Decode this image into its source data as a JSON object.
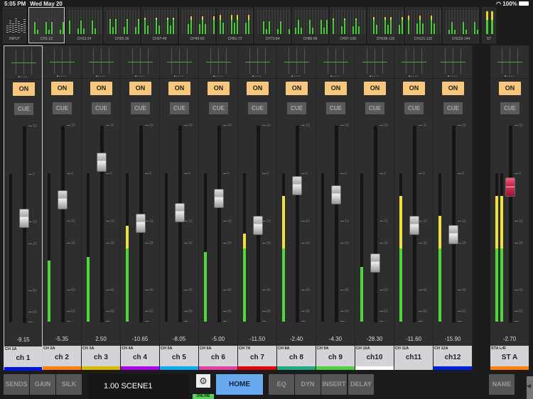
{
  "status": {
    "time": "5:05 PM",
    "date": "Wed May 20",
    "battery": "100%"
  },
  "overview": {
    "input_label": "INPUT",
    "banks": [
      "CH1-12",
      "CH13-24",
      "CH25-36",
      "CH37-48",
      "CH49-60",
      "CH61-72",
      "CH73-84",
      "CH85-96",
      "CH97-108",
      "CH109-120",
      "CH121-132",
      "CH133-144"
    ],
    "selected_bank": "CH1-12",
    "st_label": "ST"
  },
  "on_label": "ON",
  "cue_label": "CUE",
  "scale": [
    "10",
    "0",
    "10",
    "20",
    "40",
    "60",
    "-"
  ],
  "channels": [
    {
      "id": "CH 1A",
      "name": "ch 1",
      "value": "-9.15",
      "db": -9.15,
      "meter": 0,
      "color": "#0014e0"
    },
    {
      "id": "CH 2A",
      "name": "ch 2",
      "value": "-5.35",
      "db": -5.35,
      "meter": 0.31,
      "color": "#ff7f10"
    },
    {
      "id": "CH 3A",
      "name": "ch 3",
      "value": "2.50",
      "db": 2.5,
      "meter": 0.33,
      "color": "#d4bc00"
    },
    {
      "id": "CH 4A",
      "name": "ch 4",
      "value": "-10.65",
      "db": -10.65,
      "meter": 0.49,
      "color": "#b000e8"
    },
    {
      "id": "CH 5A",
      "name": "ch 5",
      "value": "-8.05",
      "db": -8.05,
      "meter": 0,
      "color": "#10a8f0"
    },
    {
      "id": "CH 6A",
      "name": "ch 6",
      "value": "-5.00",
      "db": -5.0,
      "meter": 0.355,
      "color": "#e040a0"
    },
    {
      "id": "CH 7A",
      "name": "ch 7",
      "value": "-11.50",
      "db": -11.5,
      "meter": 0.45,
      "color": "#e00010"
    },
    {
      "id": "CH 8A",
      "name": "ch 8",
      "value": "-2.40",
      "db": -2.4,
      "meter": 0.64,
      "color": "#20a880"
    },
    {
      "id": "CH 9A",
      "name": "ch 9",
      "value": "-4.30",
      "db": -4.3,
      "meter": 0,
      "color": "#50d040"
    },
    {
      "id": "CH 10A",
      "name": "ch10",
      "value": "-28.30",
      "db": -28.3,
      "meter": 0.28,
      "color": "#ffffff"
    },
    {
      "id": "CH 11A",
      "name": "ch11",
      "value": "-11.60",
      "db": -11.6,
      "meter": 0.64,
      "color": "#d4d4d8"
    },
    {
      "id": "CH 12A",
      "name": "ch12",
      "value": "-15.90",
      "db": -15.9,
      "meter": 0.54,
      "color": "#0020e0"
    }
  ],
  "stereo": {
    "id": "STA L/R",
    "name": "ST A",
    "value": "-2.70",
    "db": -2.7,
    "meter": 0.64,
    "color": "#ff7f10"
  },
  "bottom": {
    "sends": "SENDS",
    "gain": "GAIN",
    "silk": "SILK",
    "scene": "1.00 SCENE1",
    "online": "ONLINE",
    "home": "HOME",
    "eq": "EQ",
    "dyn": "DYN",
    "insert": "INSERT",
    "delay": "DELAY",
    "name": "NAME"
  }
}
